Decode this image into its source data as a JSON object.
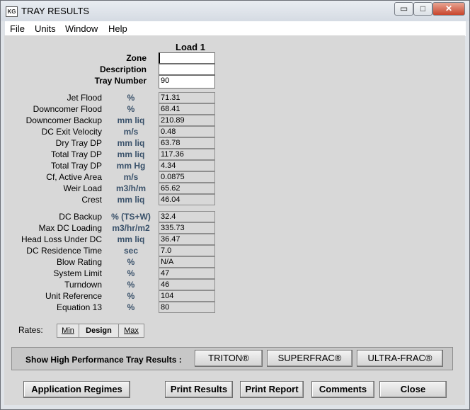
{
  "window": {
    "title": "TRAY RESULTS",
    "icon_text": "KG",
    "min_glyph": "▭",
    "max_glyph": "□",
    "close_glyph": "✕"
  },
  "menu": [
    "File",
    "Units",
    "Window",
    "Help"
  ],
  "column_header": "Load 1",
  "inputs": [
    {
      "label": "Zone",
      "value": ""
    },
    {
      "label": "Description",
      "value": ""
    },
    {
      "label": "Tray Number",
      "value": "90"
    }
  ],
  "group1": [
    {
      "label": "Jet Flood",
      "unit": "%",
      "value": "71.31"
    },
    {
      "label": "Downcomer Flood",
      "unit": "%",
      "value": "68.41"
    },
    {
      "label": "Downcomer Backup",
      "unit": "mm liq",
      "value": "210.89"
    },
    {
      "label": "DC Exit Velocity",
      "unit": "m/s",
      "value": "0.48"
    },
    {
      "label": "Dry Tray DP",
      "unit": "mm liq",
      "value": "63.78"
    },
    {
      "label": "Total Tray DP",
      "unit": "mm liq",
      "value": "117.36"
    },
    {
      "label": "Total Tray DP",
      "unit": "mm Hg",
      "value": "4.34"
    },
    {
      "label": "Cf, Active Area",
      "unit": "m/s",
      "value": "0.0875"
    },
    {
      "label": "Weir Load",
      "unit": "m3/h/m",
      "value": "65.62"
    },
    {
      "label": "Crest",
      "unit": "mm liq",
      "value": "46.04"
    }
  ],
  "group2": [
    {
      "label": "DC Backup",
      "unit": "% (TS+W)",
      "value": "32.4"
    },
    {
      "label": "Max DC Loading",
      "unit": "m3/hr/m2",
      "value": "335.73"
    },
    {
      "label": "Head Loss Under DC",
      "unit": "mm liq",
      "value": "36.47"
    },
    {
      "label": "DC Residence Time",
      "unit": "sec",
      "value": "7.0"
    },
    {
      "label": "Blow Rating",
      "unit": "%",
      "value": "N/A"
    },
    {
      "label": "System Limit",
      "unit": "%",
      "value": "47"
    },
    {
      "label": "Turndown",
      "unit": "%",
      "value": "46"
    },
    {
      "label": "Unit Reference",
      "unit": "%",
      "value": "104"
    },
    {
      "label": "Equation 13",
      "unit": "%",
      "value": "80"
    }
  ],
  "rates": {
    "label": "Rates:",
    "min": "Min",
    "design": "Design",
    "max": "Max"
  },
  "high_perf": {
    "label": "Show High Performance Tray Results :",
    "triton": "TRITON®",
    "superfrac": "SUPERFRAC®",
    "ultrafrac": "ULTRA-FRAC®"
  },
  "buttons": {
    "app_regimes": "Application Regimes",
    "print_results": "Print Results",
    "print_report": "Print Report",
    "comments": "Comments",
    "close": "Close"
  }
}
